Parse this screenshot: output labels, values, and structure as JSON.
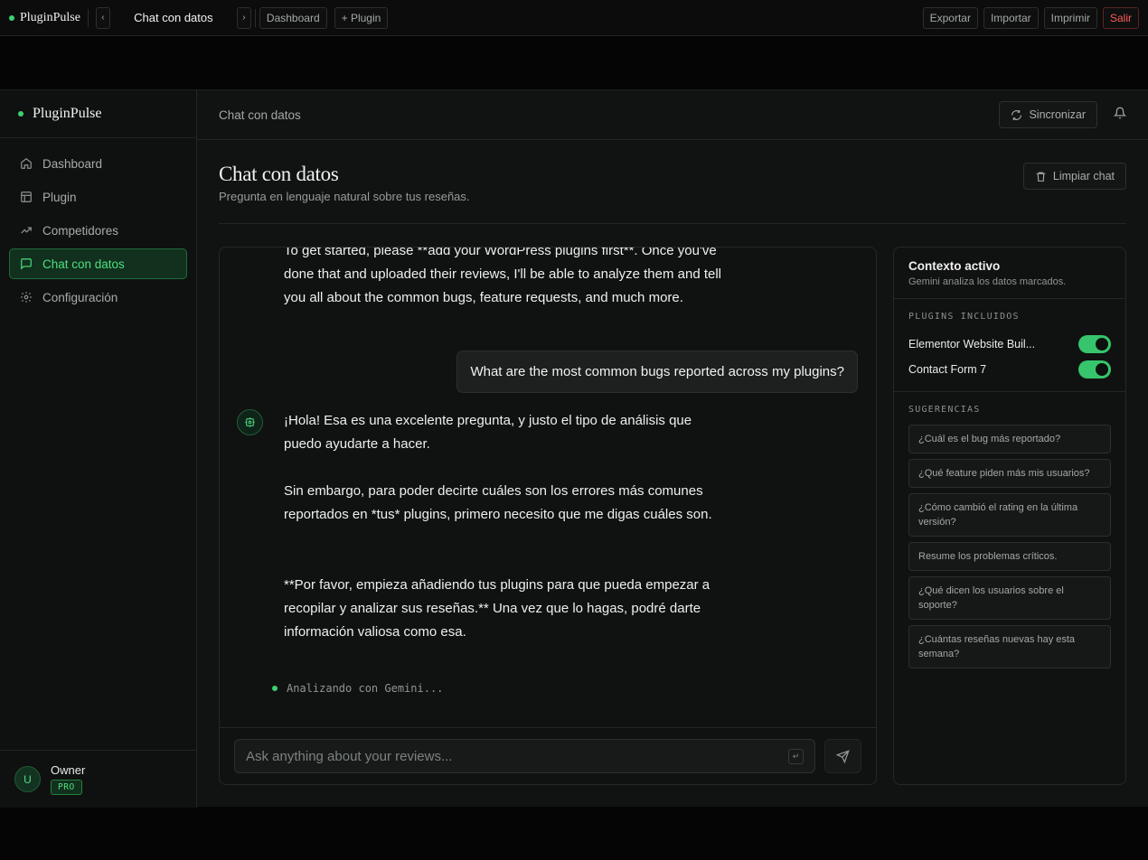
{
  "topbar": {
    "brand": "PluginPulse",
    "prev": "‹",
    "title": "Chat con datos",
    "next": "›",
    "dashboard": "Dashboard",
    "add_plugin": "+ Plugin",
    "export": "Exportar",
    "import": "Importar",
    "print": "Imprimir",
    "exit": "Salir"
  },
  "sidebar": {
    "brand": "PluginPulse",
    "items": [
      {
        "label": "Dashboard",
        "icon": "home-icon"
      },
      {
        "label": "Plugin",
        "icon": "layout-icon"
      },
      {
        "label": "Competidores",
        "icon": "trending-up-icon"
      },
      {
        "label": "Chat con datos",
        "icon": "message-square-icon",
        "active": true
      },
      {
        "label": "Configuración",
        "icon": "gear-icon"
      }
    ],
    "user": {
      "initial": "U",
      "name": "Owner",
      "plan": "PRO"
    }
  },
  "header": {
    "breadcrumb": "Chat con datos",
    "sync": "Sincronizar"
  },
  "page": {
    "title": "Chat con datos",
    "subtitle": "Pregunta en lenguaje natural sobre tus reseñas.",
    "clear": "Limpiar chat"
  },
  "chat": {
    "messages": [
      {
        "role": "assistant",
        "text": "To get started, please **add your WordPress plugins first**. Once you've done that and uploaded their reviews, I'll be able to analyze them and tell you all about the common bugs, feature requests, and much more."
      },
      {
        "role": "user",
        "text": "What are the most common bugs reported across my plugins?"
      },
      {
        "role": "assistant",
        "p1": "¡Hola! Esa es una excelente pregunta, y justo el tipo de análisis que puedo ayudarte a hacer.",
        "p2": "Sin embargo, para poder decirte cuáles son los errores más comunes reportados en *tus* plugins, primero necesito que me digas cuáles son.",
        "p3": "**Por favor, empieza añadiendo tus plugins para que pueda empezar a recopilar y analizar sus reseñas.** Una vez que lo hagas, podré darte información valiosa como esa."
      }
    ],
    "status": "Analizando con Gemini...",
    "input_placeholder": "Ask anything about your reviews...",
    "enter_hint": "↵"
  },
  "context": {
    "title": "Contexto activo",
    "subtitle": "Gemini analiza los datos marcados.",
    "plugins_label": "PLUGINS INCLUIDOS",
    "plugins": [
      {
        "name": "Elementor Website Buil...",
        "enabled": true
      },
      {
        "name": "Contact Form 7",
        "enabled": true
      }
    ],
    "suggestions_label": "SUGERENCIAS",
    "suggestions": [
      "¿Cuál es el bug más reportado?",
      "¿Qué feature piden más mis usuarios?",
      "¿Cómo cambió el rating en la última versión?",
      "Resume los problemas críticos.",
      "¿Qué dicen los usuarios sobre el soporte?",
      "¿Cuántas reseñas nuevas hay esta semana?"
    ]
  },
  "colors": {
    "accent": "#3ed072",
    "danger": "#ff5c5c",
    "background": "#111312"
  }
}
